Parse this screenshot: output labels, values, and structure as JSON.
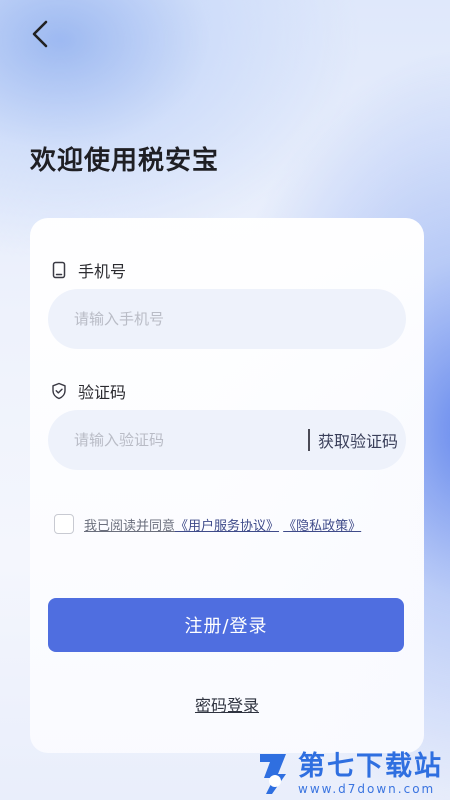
{
  "header": {
    "back_icon": "chevron-left-icon",
    "welcome_title": "欢迎使用税安宝"
  },
  "form": {
    "phone": {
      "label": "手机号",
      "icon": "phone-icon",
      "placeholder": "请输入手机号",
      "value": ""
    },
    "code": {
      "label": "验证码",
      "icon": "shield-check-icon",
      "placeholder": "请输入验证码",
      "value": "",
      "get_code_label": "获取验证码"
    },
    "agreement": {
      "checked": false,
      "prefix": "我已阅读并同意",
      "user_agreement": "《用户服务协议》",
      "privacy_policy": "《隐私政策》"
    },
    "submit_label": "注册/登录",
    "password_login_label": "密码登录"
  },
  "watermark": {
    "title": "第七下载站",
    "url": "www.d7down.com"
  },
  "colors": {
    "accent": "#4f6ee0",
    "input_bg": "#eef2fb",
    "watermark": "#2f6fe0"
  }
}
